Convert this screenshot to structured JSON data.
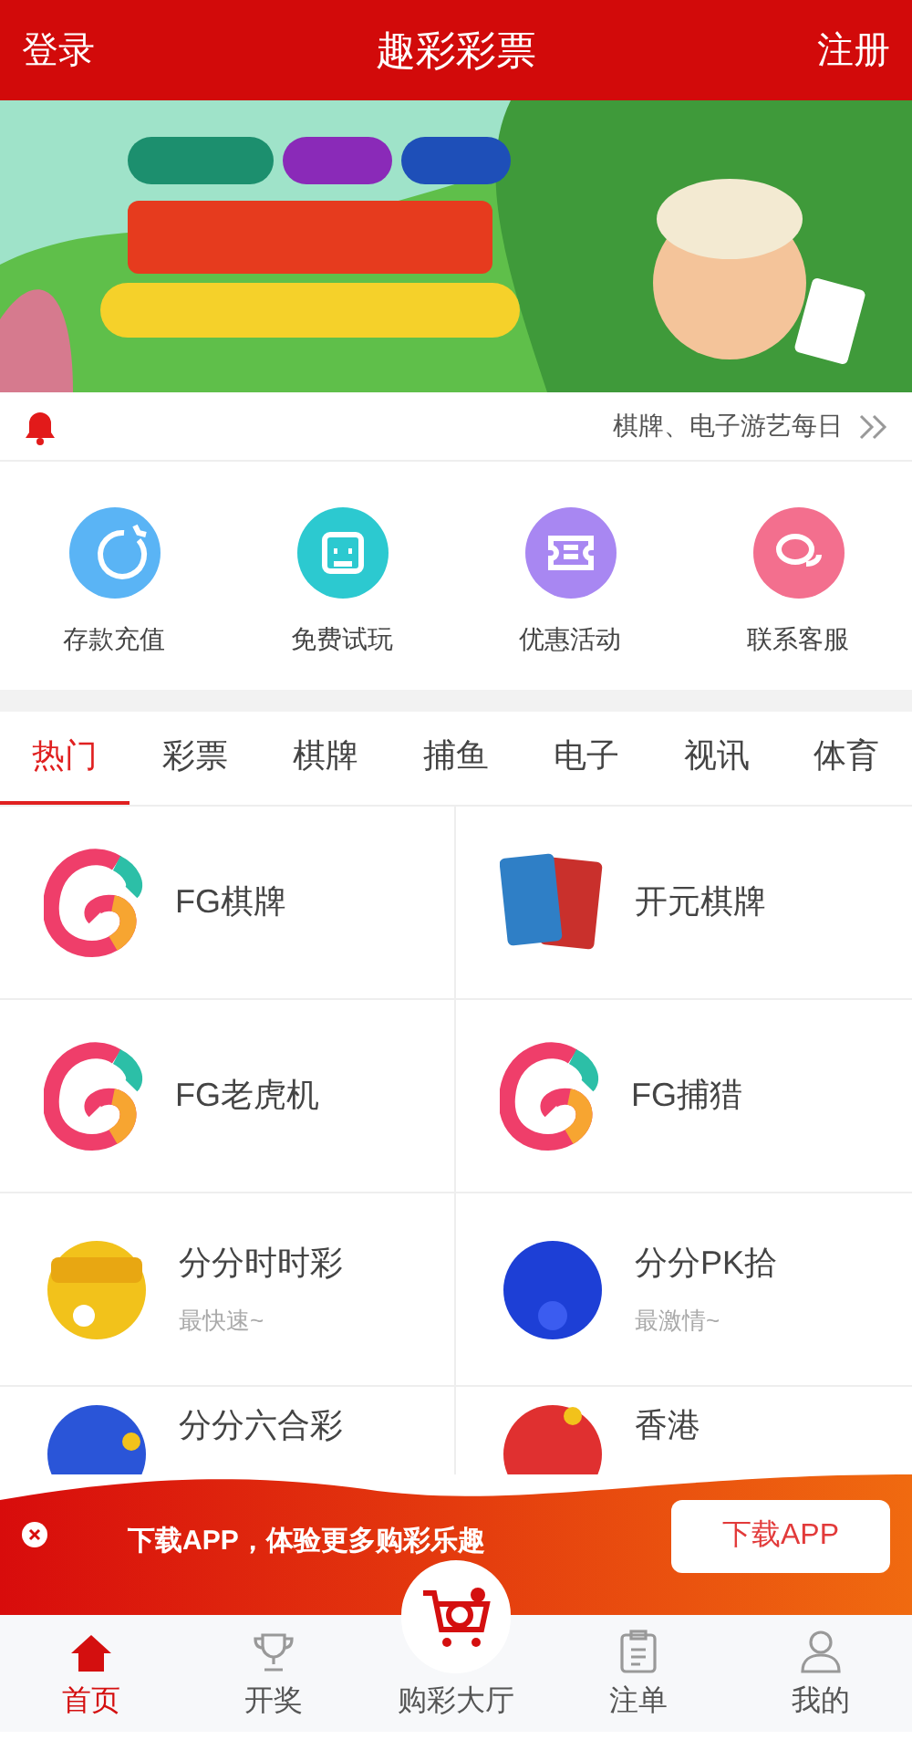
{
  "header": {
    "left": "登录",
    "title": "趣彩彩票",
    "right": "注册"
  },
  "notice": {
    "text": "棋牌、电子游艺每日"
  },
  "quick_links": [
    {
      "label": "存款充值",
      "kind": "deposit",
      "color": "#5ab4f5"
    },
    {
      "label": "免费试玩",
      "kind": "trial",
      "color": "#2cc9d0"
    },
    {
      "label": "优惠活动",
      "kind": "promo",
      "color": "#a887f2"
    },
    {
      "label": "联系客服",
      "kind": "service",
      "color": "#f36f8e"
    }
  ],
  "tabs": [
    {
      "label": "热门",
      "selected": true
    },
    {
      "label": "彩票",
      "selected": false
    },
    {
      "label": "棋牌",
      "selected": false
    },
    {
      "label": "捕鱼",
      "selected": false
    },
    {
      "label": "电子",
      "selected": false
    },
    {
      "label": "视讯",
      "selected": false
    },
    {
      "label": "体育",
      "selected": false
    }
  ],
  "games": [
    {
      "name": "FG棋牌",
      "kind": "fg"
    },
    {
      "name": "开元棋牌",
      "kind": "ky"
    },
    {
      "name": "FG老虎机",
      "kind": "fg"
    },
    {
      "name": "FG捕猎",
      "kind": "fg"
    },
    {
      "name": "分分时时彩",
      "subtitle": "最快速~",
      "kind": "ssc"
    },
    {
      "name": "分分PK拾",
      "subtitle": "最激情~",
      "kind": "pk"
    },
    {
      "name": "分分六合彩",
      "kind": "lhc"
    },
    {
      "name": "香港",
      "kind": "hk"
    }
  ],
  "download_bar": {
    "text": "下载APP，体验更多购彩乐趣",
    "button": "下载APP"
  },
  "nav": [
    {
      "label": "首页",
      "kind": "home",
      "selected": true
    },
    {
      "label": "开奖",
      "kind": "trophy",
      "selected": false
    },
    {
      "label": "购彩大厅",
      "kind": "cart",
      "selected": false
    },
    {
      "label": "注单",
      "kind": "clipboard",
      "selected": false
    },
    {
      "label": "我的",
      "kind": "user",
      "selected": false
    }
  ]
}
